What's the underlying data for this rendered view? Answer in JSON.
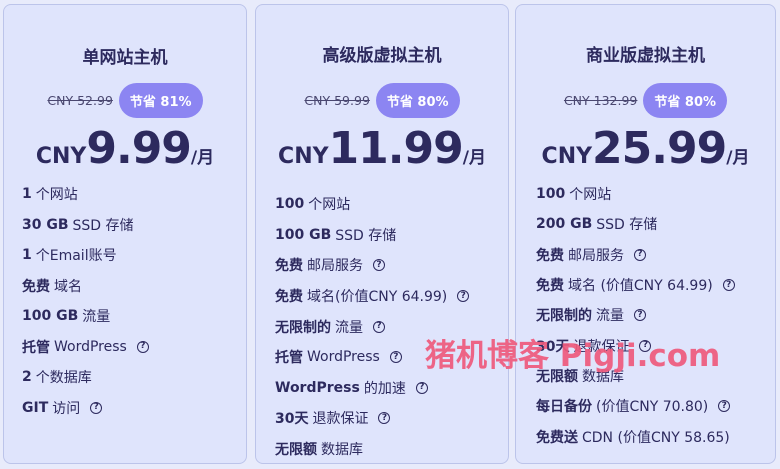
{
  "plans": [
    {
      "title": "单网站主机",
      "old_price": "CNY 52.99",
      "badge": "节省 81%",
      "currency": "CNY",
      "price": "9.99",
      "period": "/月",
      "features": [
        {
          "bold": "1",
          "text": "个网站",
          "info": false
        },
        {
          "bold": "30 GB",
          "text": "SSD 存储",
          "info": false
        },
        {
          "bold": "1",
          "text": "个Email账号",
          "info": false
        },
        {
          "bold": "免费",
          "text": "域名",
          "info": false
        },
        {
          "bold": "100 GB",
          "text": "流量",
          "info": false
        },
        {
          "bold": "托管",
          "text": "WordPress",
          "info": true
        },
        {
          "bold": "2",
          "text": "个数据库",
          "info": false
        },
        {
          "bold": "GIT",
          "text": "访问",
          "info": true
        }
      ]
    },
    {
      "title": "高级版虚拟主机",
      "old_price": "CNY 59.99",
      "badge": "节省 80%",
      "currency": "CNY",
      "price": "11.99",
      "period": "/月",
      "features": [
        {
          "bold": "100",
          "text": "个网站",
          "info": false
        },
        {
          "bold": "100 GB",
          "text": "SSD 存储",
          "info": false
        },
        {
          "bold": "免费",
          "text": "邮局服务",
          "info": true
        },
        {
          "bold": "免费",
          "text": "域名(价值CNY 64.99)",
          "info": true
        },
        {
          "bold": "无限制的",
          "text": "流量",
          "info": true
        },
        {
          "bold": "托管",
          "text": "WordPress",
          "info": true
        },
        {
          "bold": "WordPress",
          "text": "的加速",
          "info": true
        },
        {
          "bold": "30天",
          "text": "退款保证",
          "info": true
        },
        {
          "bold": "无限额",
          "text": "数据库",
          "info": false
        }
      ]
    },
    {
      "title": "商业版虚拟主机",
      "old_price": "CNY 132.99",
      "badge": "节省 80%",
      "currency": "CNY",
      "price": "25.99",
      "period": "/月",
      "features": [
        {
          "bold": "100",
          "text": "个网站",
          "info": false
        },
        {
          "bold": "200 GB",
          "text": "SSD 存储",
          "info": false
        },
        {
          "bold": "免费",
          "text": "邮局服务",
          "info": true
        },
        {
          "bold": "免费",
          "text": "域名 (价值CNY 64.99)",
          "info": true
        },
        {
          "bold": "无限制的",
          "text": "流量",
          "info": true
        },
        {
          "bold": "30天",
          "text": "退款保证",
          "info": true
        },
        {
          "bold": "无限额",
          "text": "数据库",
          "info": false
        },
        {
          "bold": "每日备份",
          "text": "(价值CNY 70.80)",
          "info": true
        },
        {
          "bold": "免费送",
          "text": "CDN (价值CNY 58.65)",
          "info": false
        }
      ]
    }
  ],
  "watermark": "猪机博客 Pigji.com",
  "info_glyph": "?",
  "colors": {
    "accent": "#8c85f2",
    "text": "#2d2a5e",
    "card": "#dfe4fc",
    "watermark": "#ef5a7c"
  }
}
